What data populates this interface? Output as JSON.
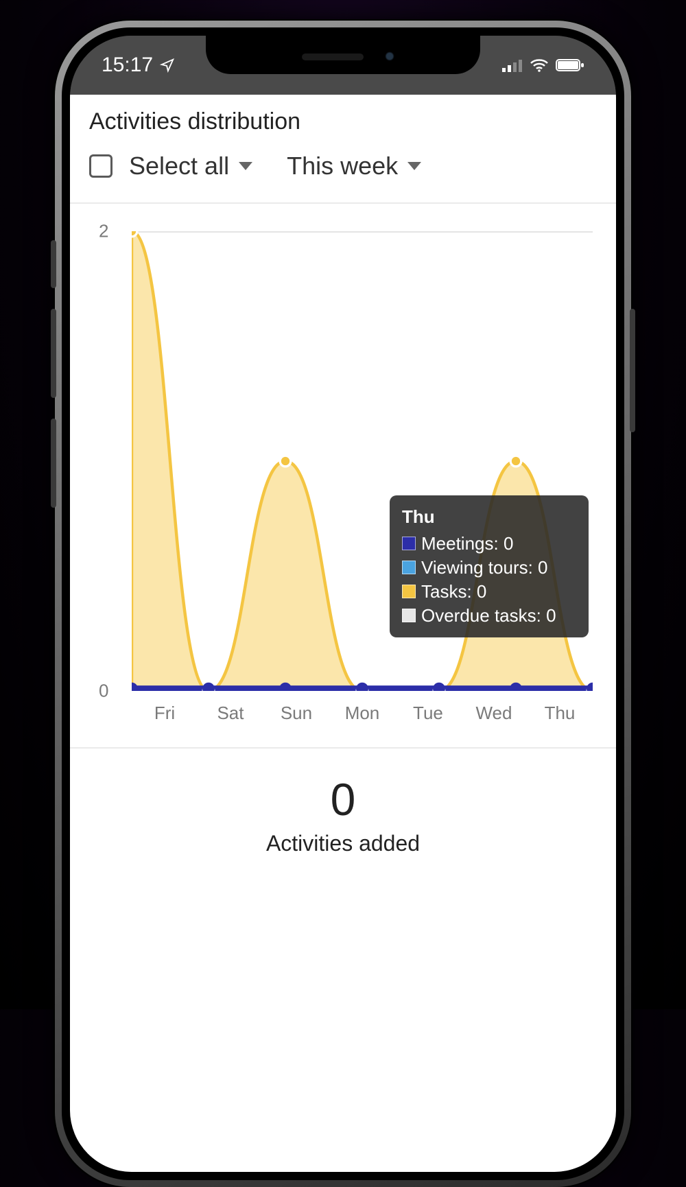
{
  "status": {
    "time": "15:17"
  },
  "header": {
    "title": "Activities distribution"
  },
  "filters": {
    "select_all_label": "Select all",
    "range_label": "This week"
  },
  "summary": {
    "value": "0",
    "label": "Activities added"
  },
  "tooltip": {
    "title": "Thu",
    "rows": {
      "meetings": "Meetings: 0",
      "viewing": "Viewing tours: 0",
      "tasks": "Tasks: 0",
      "overdue": "Overdue tasks: 0"
    }
  },
  "yticks": {
    "min": "0",
    "max": "2"
  },
  "xticks": {
    "d0": "Fri",
    "d1": "Sat",
    "d2": "Sun",
    "d3": "Mon",
    "d4": "Tue",
    "d5": "Wed",
    "d6": "Thu"
  },
  "colors": {
    "tasks": "#f4c542",
    "tasks_fill": "#f9dd8f",
    "meetings": "#2c2ea8",
    "viewing": "#4aa3e0",
    "overdue": "#e6e6e6"
  },
  "chart_data": {
    "type": "area",
    "categories": [
      "Fri",
      "Sat",
      "Sun",
      "Mon",
      "Tue",
      "Wed",
      "Thu"
    ],
    "ylim": [
      0,
      2
    ],
    "ylabel": "",
    "xlabel": "",
    "title": "Activities distribution",
    "series": [
      {
        "name": "Tasks",
        "color": "#f4c542",
        "values": [
          2,
          0,
          1,
          0,
          0,
          1,
          0
        ]
      },
      {
        "name": "Meetings",
        "color": "#2c2ea8",
        "values": [
          0,
          0,
          0,
          0,
          0,
          0,
          0
        ]
      },
      {
        "name": "Viewing tours",
        "color": "#4aa3e0",
        "values": [
          0,
          0,
          0,
          0,
          0,
          0,
          0
        ]
      },
      {
        "name": "Overdue tasks",
        "color": "#e6e6e6",
        "values": [
          0,
          0,
          0,
          0,
          0,
          0,
          0
        ]
      }
    ],
    "tooltip_day": "Thu",
    "tooltip_values": {
      "Meetings": 0,
      "Viewing tours": 0,
      "Tasks": 0,
      "Overdue tasks": 0
    }
  }
}
